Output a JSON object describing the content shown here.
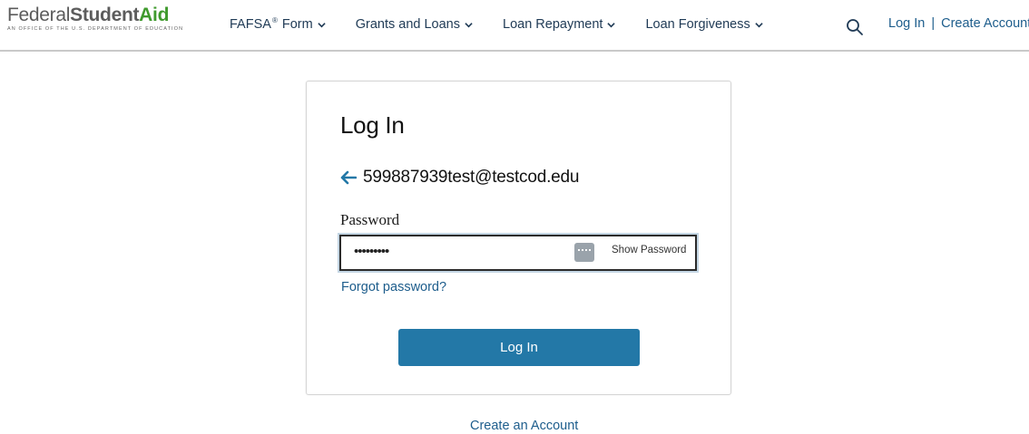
{
  "header": {
    "logo": {
      "federal": "Federal",
      "student": "Student",
      "aid": "Aid",
      "tagline": "An OFFICE of the U.S. DEPARTMENT of EDUCATION"
    },
    "nav": [
      {
        "label": "FAFSA",
        "sup": "®",
        "suffix": "Form"
      },
      {
        "label": "Grants and Loans"
      },
      {
        "label": "Loan Repayment"
      },
      {
        "label": "Loan Forgiveness"
      }
    ],
    "auth": {
      "login": "Log In",
      "separator": "|",
      "create": "Create Account"
    }
  },
  "login_card": {
    "title": "Log In",
    "email": "599887939test@testcod.edu",
    "password_label": "Password",
    "password_value": "•••••••••",
    "show_password": "Show Password",
    "forgot_password": "Forgot password?",
    "submit_label": "Log In"
  },
  "footer": {
    "create_account": "Create an Account"
  },
  "colors": {
    "link": "#1d5d8c",
    "nav_text": "#1f3a55",
    "button": "#2378a7",
    "brand_green": "#3f9a2d"
  },
  "icons": [
    "search-icon",
    "chevron-down-icon",
    "back-arrow-icon",
    "password-manager-key-icon"
  ]
}
